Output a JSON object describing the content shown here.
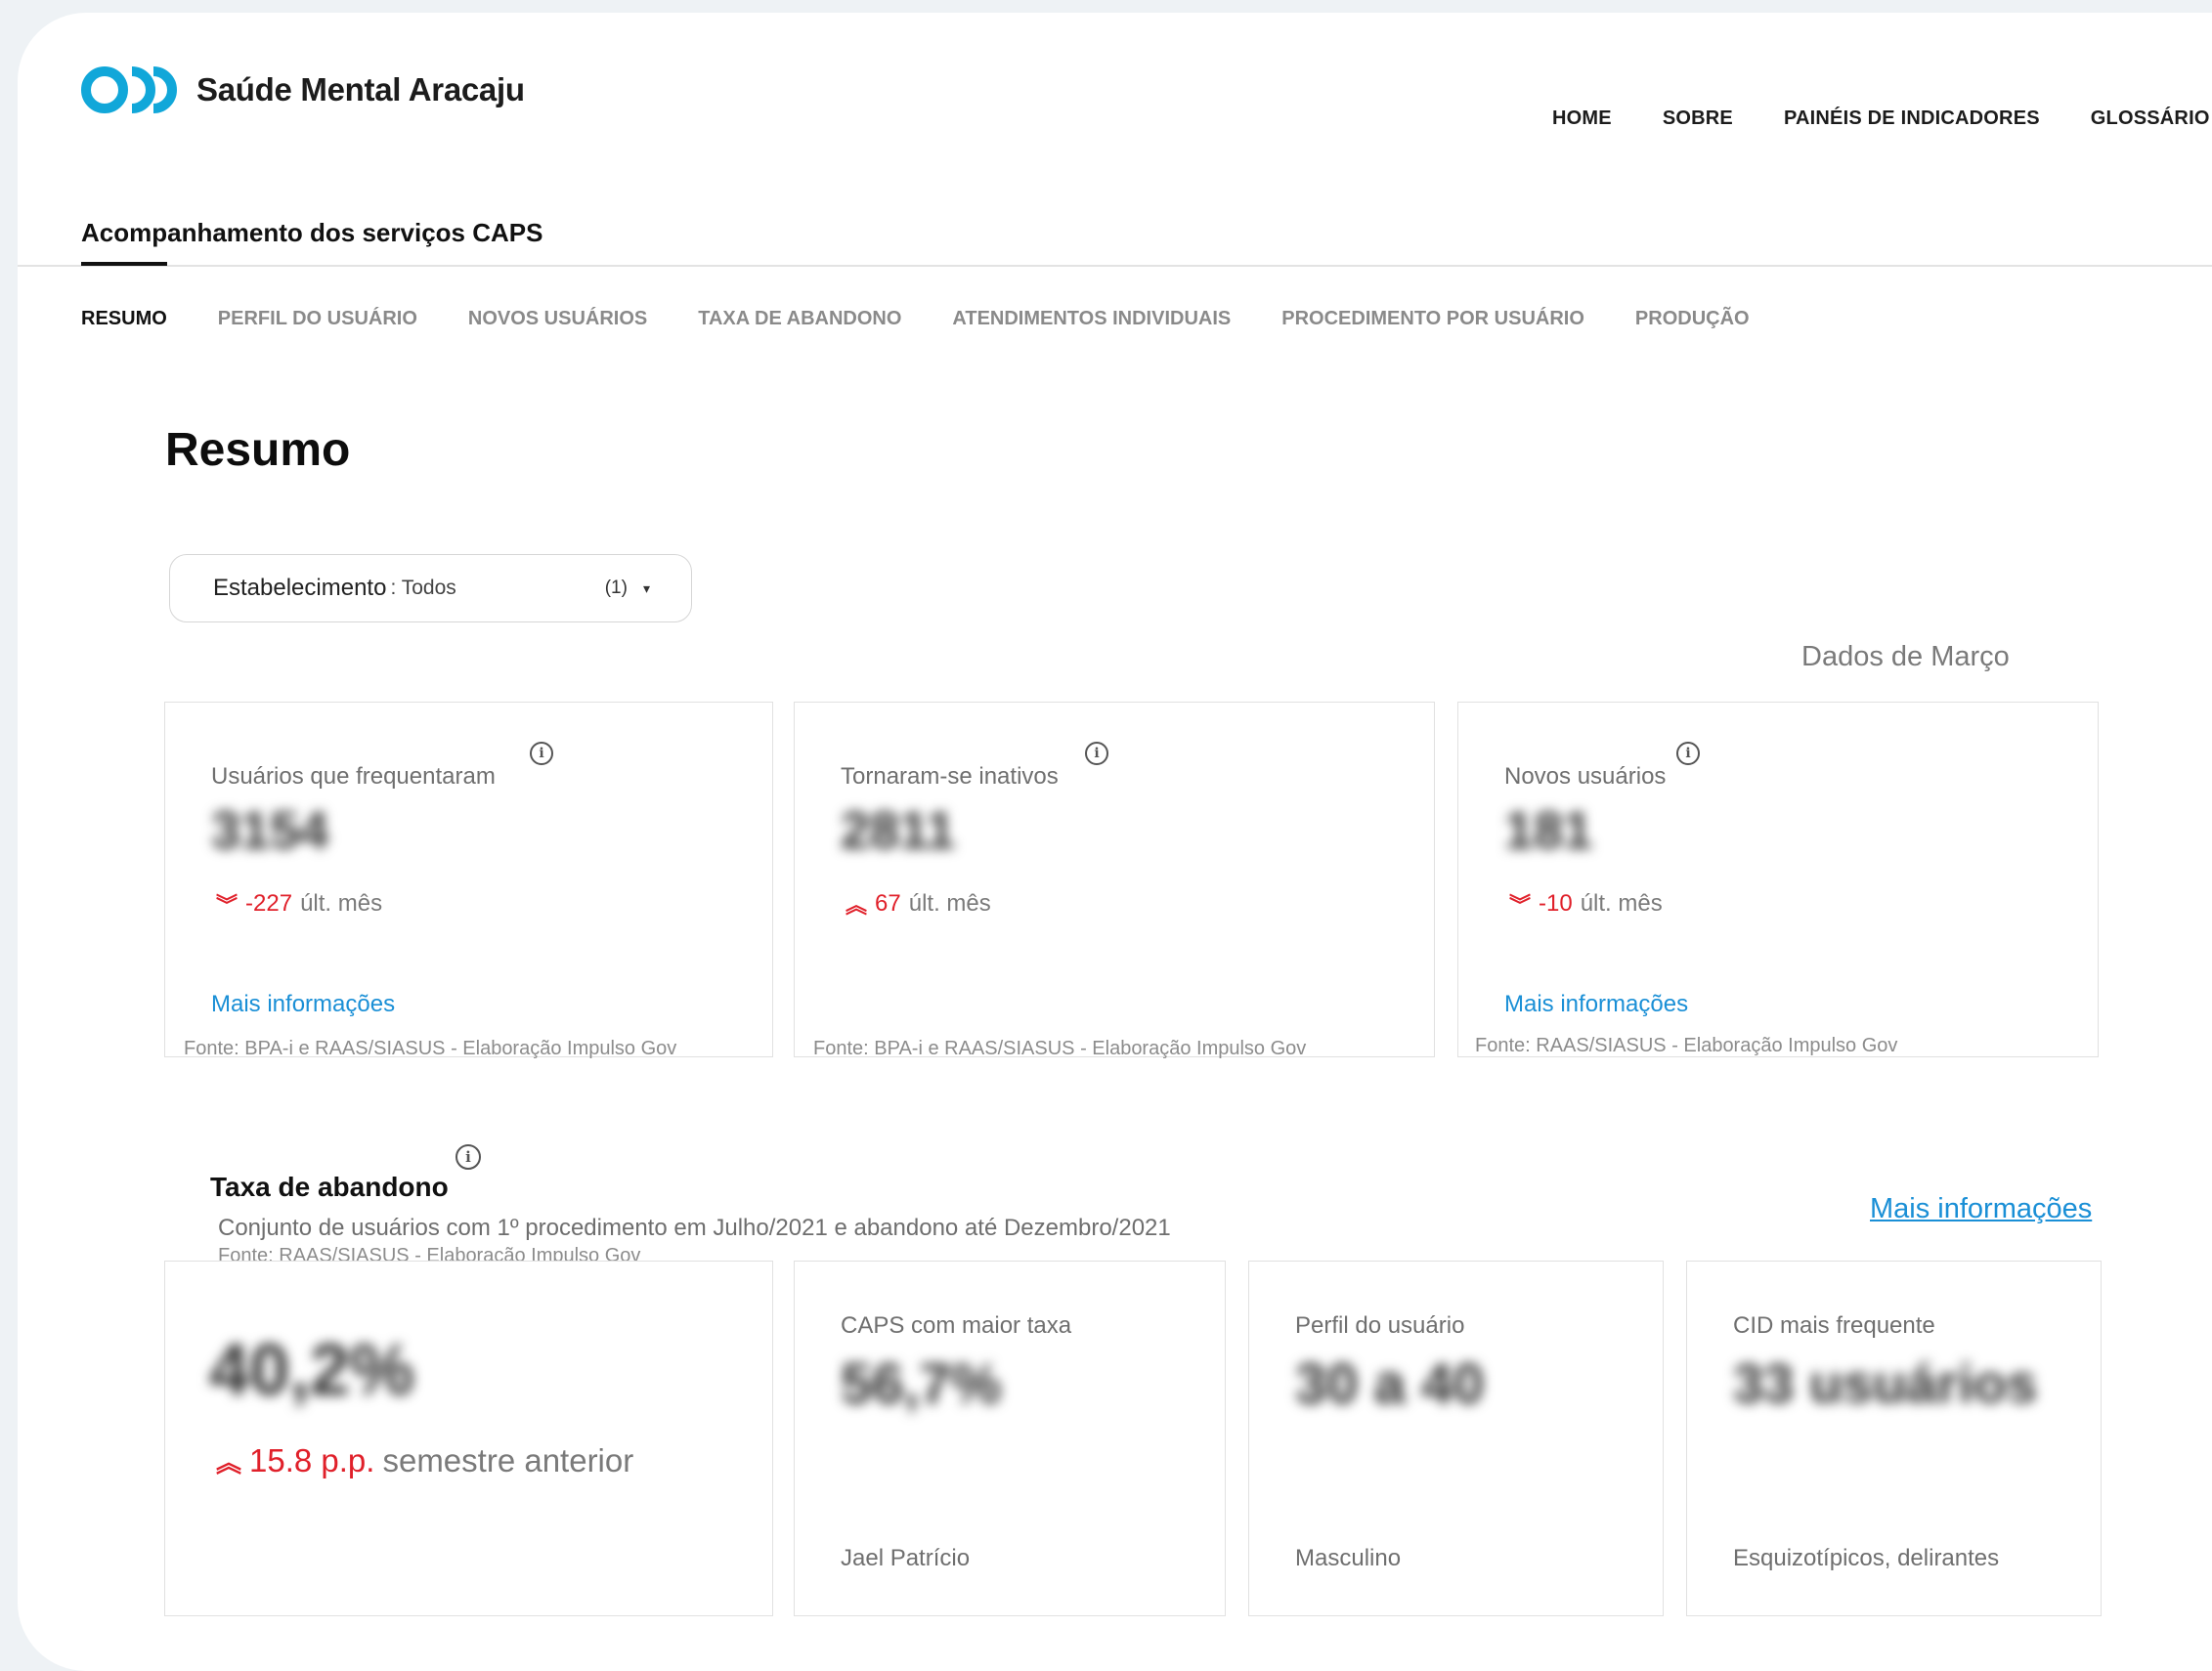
{
  "brand": {
    "name": "Saúde Mental Aracaju",
    "accent": "#11a7d9"
  },
  "nav": {
    "home": "HOME",
    "sobre": "SOBRE",
    "paineis": "PAINÉIS DE INDICADORES",
    "glossario": "GLOSSÁRIO"
  },
  "section_title": "Acompanhamento dos serviços CAPS",
  "tabs": [
    {
      "label": "RESUMO",
      "active": true
    },
    {
      "label": "PERFIL DO USUÁRIO"
    },
    {
      "label": "NOVOS USUÁRIOS"
    },
    {
      "label": "TAXA DE ABANDONO"
    },
    {
      "label": "ATENDIMENTOS INDIVIDUAIS"
    },
    {
      "label": "PROCEDIMENTO POR USUÁRIO"
    },
    {
      "label": "PRODUÇÃO"
    }
  ],
  "page_heading": "Resumo",
  "filter": {
    "label": "Estabelecimento",
    "value": ": Todos",
    "count": "(1)",
    "caret": "▾"
  },
  "period": "Dados de Março",
  "info_glyph": "i",
  "cards": [
    {
      "title": "Usuários que frequentaram",
      "value": "3154",
      "arrow": "︾",
      "delta": "-227",
      "delta_text": "últ. mês",
      "more": "Mais informações",
      "source": "Fonte: BPA-i e RAAS/SIASUS - Elaboração Impulso Gov"
    },
    {
      "title": "Tornaram-se inativos",
      "value": "2811",
      "arrow": "︽",
      "delta": "67",
      "delta_text": "últ. mês",
      "source": "Fonte: BPA-i e RAAS/SIASUS - Elaboração Impulso Gov"
    },
    {
      "title": "Novos usuários",
      "value": "181",
      "arrow": "︾",
      "delta": "-10",
      "delta_text": "últ. mês",
      "more": "Mais informações",
      "source": "Fonte: RAAS/SIASUS - Elaboração Impulso Gov"
    }
  ],
  "abandono": {
    "title": "Taxa de abandono",
    "subtitle": "Conjunto de usuários com 1º procedimento em Julho/2021 e abandono até Dezembro/2021",
    "source": "Fonte: RAAS/SIASUS - Elaboração Impulso Gov",
    "more": "Mais informações",
    "main": {
      "value": "40,2%",
      "arrow": "︽",
      "delta": "15.8 p.p.",
      "delta_text": "semestre anterior"
    },
    "caps": {
      "label": "CAPS com maior taxa",
      "value": "56,7%",
      "footer": "Jael Patrício"
    },
    "perfil": {
      "label": "Perfil do usuário",
      "value": "30 a 40",
      "footer": "Masculino"
    },
    "cid": {
      "label": "CID mais frequente",
      "value": "33 usuários",
      "footer": "Esquizotípicos, delirantes"
    }
  }
}
